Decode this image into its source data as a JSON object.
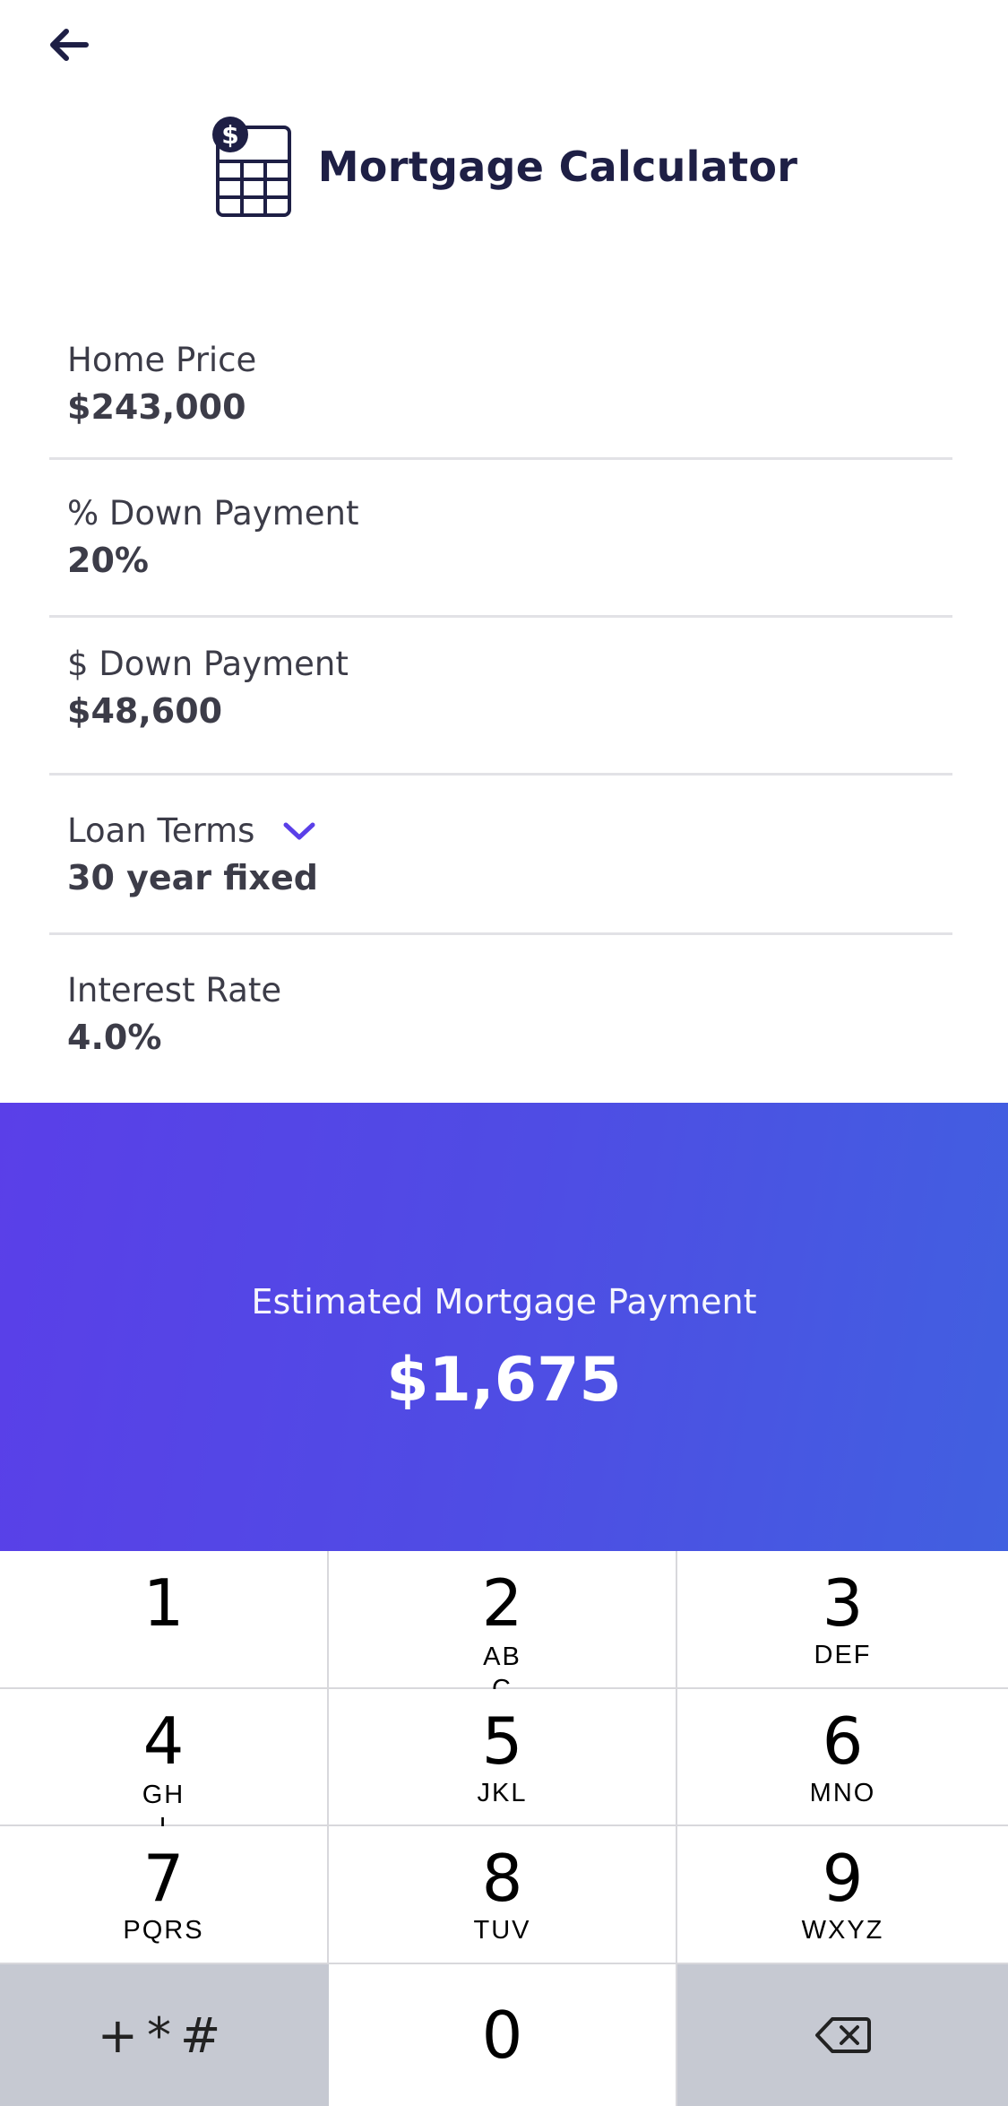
{
  "header": {
    "title": "Mortgage Calculator",
    "icon": "dollar-grid-icon"
  },
  "fields": [
    {
      "label": "Home Price",
      "value": "$243,000"
    },
    {
      "label": "% Down Payment",
      "value": "20%"
    },
    {
      "label": "$ Down Payment",
      "value": "$48,600"
    },
    {
      "label": "Loan Terms",
      "value": "30 year fixed",
      "icon": "chevron-down-icon"
    },
    {
      "label": "Interest Rate",
      "value": "4.0%"
    }
  ],
  "result": {
    "label": "Estimated Mortgage Payment",
    "value": "$1,675"
  },
  "keypad": {
    "keys": [
      {
        "digit": "1",
        "letters": ""
      },
      {
        "digit": "2",
        "letters": "ABC"
      },
      {
        "digit": "3",
        "letters": "DEF"
      },
      {
        "digit": "4",
        "letters": "GHI"
      },
      {
        "digit": "5",
        "letters": "JKL"
      },
      {
        "digit": "6",
        "letters": "MNO"
      },
      {
        "digit": "7",
        "letters": "PQRS"
      },
      {
        "digit": "8",
        "letters": "TUV"
      },
      {
        "digit": "9",
        "letters": "WXYZ"
      }
    ],
    "symbols": "+*#",
    "zero": "0"
  },
  "colors": {
    "title": "#1e1f45",
    "text": "#3c3c48",
    "accent": "#5a3fe8",
    "gradient_end": "#4160e0",
    "keypad_dark": "#c6c9d2"
  }
}
